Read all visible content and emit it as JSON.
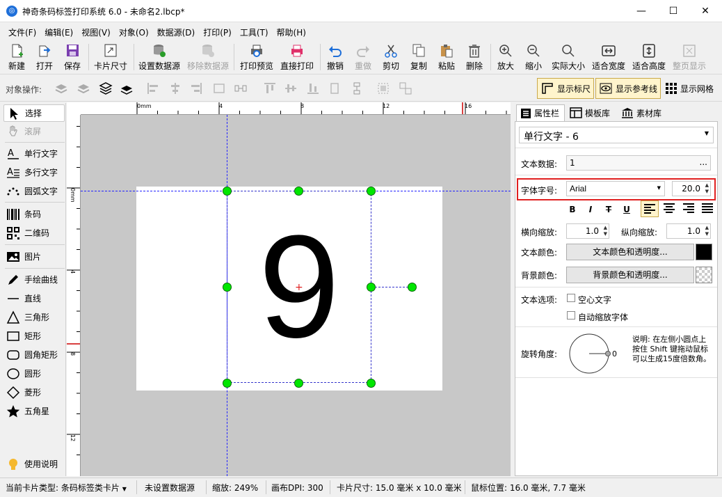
{
  "window": {
    "title": "神奇条码标签打印系统 6.0 - 未命名2.lbcp*",
    "minimize": "—",
    "maximize": "☐",
    "close": "✕"
  },
  "menu": [
    "文件(F)",
    "编辑(E)",
    "视图(V)",
    "对象(O)",
    "数据源(D)",
    "打印(P)",
    "工具(T)",
    "帮助(H)"
  ],
  "toolbar": {
    "new": "新建",
    "open": "打开",
    "save": "保存",
    "card_size": "卡片尺寸",
    "set_datasource": "设置数据源",
    "remove_datasource": "移除数据源",
    "print_preview": "打印预览",
    "direct_print": "直接打印",
    "undo": "撤销",
    "redo": "重做",
    "cut": "剪切",
    "copy": "复制",
    "paste": "粘贴",
    "delete": "删除",
    "zoom_in": "放大",
    "zoom_out": "缩小",
    "actual_size": "实际大小",
    "fit_width": "适合宽度",
    "fit_height": "适合高度",
    "whole_page": "整页显示"
  },
  "object_bar": {
    "label": "对象操作:",
    "show_ruler": "显示标尺",
    "show_guides": "显示参考线",
    "show_grid": "显示网格"
  },
  "tools": {
    "select": "选择",
    "scroll": "滚屏",
    "single_text": "单行文字",
    "multi_text": "多行文字",
    "arc_text": "圆弧文字",
    "barcode": "条码",
    "qrcode": "二维码",
    "image": "图片",
    "freehand": "手绘曲线",
    "line": "直线",
    "triangle": "三角形",
    "rectangle": "矩形",
    "rounded_rect": "圆角矩形",
    "circle": "圆形",
    "diamond": "菱形",
    "star": "五角星",
    "help": "使用说明"
  },
  "ruler": {
    "top": [
      "0mm",
      "4",
      "8",
      "12",
      "16"
    ],
    "left": [
      "0mm",
      "4",
      "8",
      "12"
    ]
  },
  "canvas": {
    "text": "9"
  },
  "panel": {
    "tabs": [
      "属性栏",
      "模板库",
      "素材库"
    ],
    "object_type": "单行文字 - 6",
    "text_data_label": "文本数据:",
    "text_data": "1",
    "text_data_btn": "...",
    "font_label": "字体字号:",
    "font": "Arial",
    "font_size": "20.0",
    "bold": "B",
    "italic": "I",
    "strike": "T",
    "underline": "U",
    "hscale_label": "横向缩放:",
    "hscale": "1.0",
    "vscale_label": "纵向缩放:",
    "vscale": "1.0",
    "text_color_label": "文本颜色:",
    "text_color_btn": "文本颜色和透明度...",
    "bg_color_label": "背景颜色:",
    "bg_color_btn": "背景颜色和透明度...",
    "text_options_label": "文本选项:",
    "hollow_text": "空心文字",
    "auto_shrink": "自动缩放字体",
    "rotate_label": "旋转角度:",
    "rotate_value": "0",
    "rotate_note": "说明: 在左侧小圆点上按住 Shift 键拖动鼠标可以生成15度倍数角。"
  },
  "status": {
    "card_type": "当前卡片类型: 条码标签类卡片",
    "datasource": "未设置数据源",
    "zoom": "缩放: 249%",
    "dpi": "画布DPI: 300",
    "card_size": "卡片尺寸: 15.0 毫米 x 10.0 毫米",
    "mouse_pos": "鼠标位置: 16.0 毫米, 7.7 毫米"
  },
  "colors": {
    "accent": "#1e6fd9",
    "handle": "#00e600",
    "selection": "#3333cc",
    "guide": "#2222ff",
    "highlight_border": "#e02020"
  }
}
